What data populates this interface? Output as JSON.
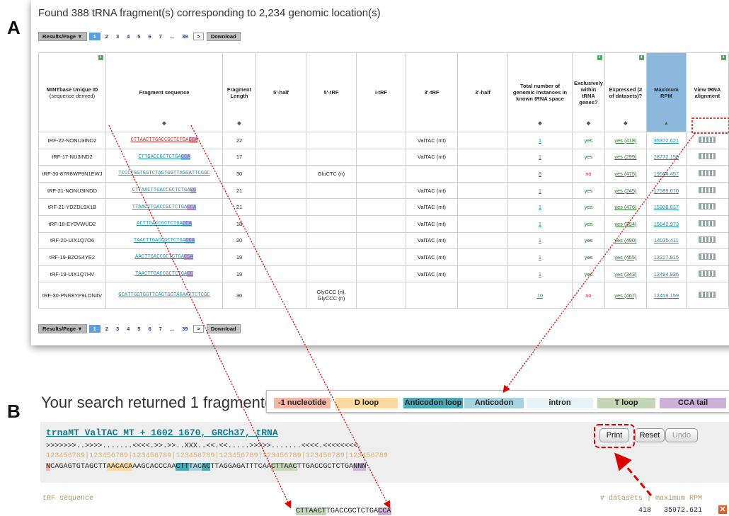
{
  "panelA": {
    "letter": "A",
    "found_text": "Found 388 tRNA fragment(s) corresponding to 2,234 genomic location(s)",
    "pager": {
      "results_per_page": "Results/Page ▼",
      "pages": [
        "1",
        "2",
        "3",
        "4",
        "5",
        "6",
        "7",
        "...",
        "39"
      ],
      "current_page": "1",
      "next": ">",
      "download": "Download"
    },
    "columns": [
      {
        "label": "MINTbase Unique ID",
        "sub": "(sequence derived)",
        "info": true,
        "sort": ""
      },
      {
        "label": "Fragment sequence",
        "sub": "",
        "info": false,
        "sort": "◆"
      },
      {
        "label": "Fragment Length",
        "sub": "",
        "info": false,
        "sort": "◆"
      },
      {
        "label": "5'-half",
        "sub": "",
        "info": false,
        "sort": ""
      },
      {
        "label": "5'-tRF",
        "sub": "",
        "info": false,
        "sort": ""
      },
      {
        "label": "i-tRF",
        "sub": "",
        "info": false,
        "sort": ""
      },
      {
        "label": "3'-tRF",
        "sub": "",
        "info": false,
        "sort": ""
      },
      {
        "label": "3'-half",
        "sub": "",
        "info": false,
        "sort": ""
      },
      {
        "label": "Total number of genomic instances in known tRNA space",
        "sub": "",
        "info": false,
        "sort": "◆"
      },
      {
        "label": "Exclusively within tRNA genes?",
        "sub": "",
        "info": true,
        "sort": "◆"
      },
      {
        "label": "Expressed (# of datasets)?",
        "sub": "",
        "info": true,
        "sort": "◆"
      },
      {
        "label": "Maximum RPM",
        "sub": "",
        "info": false,
        "sort": "▲"
      },
      {
        "label": "View tRNA alignment",
        "sub": "",
        "info": true,
        "sort": ""
      }
    ],
    "rows": [
      {
        "id": "tRF-22-NONU3IND2",
        "seq": "CTTAACTTGACCGCTCTGA",
        "cca": "CCA",
        "len": "22",
        "half5": "",
        "trf5": "",
        "itrf": "",
        "trf3": "ValTAC (mt)",
        "half3": "",
        "total": "1",
        "excl": "yes",
        "expr": "yes (418)",
        "rpm": "35972.621"
      },
      {
        "id": "tRF-17-NU3IND2",
        "seq": "CTTGACCGCTCTGA",
        "cca": "CCA",
        "len": "17",
        "half5": "",
        "trf5": "",
        "itrf": "",
        "trf3": "ValTAC (mt)",
        "half3": "",
        "total": "1",
        "excl": "yes",
        "expr": "yes (299)",
        "rpm": "28772.150"
      },
      {
        "id": "tRF-30-87R8WP9N1EWJ",
        "seq": "TCCCTGGTGGTCTAGTGGTTAGGATTCGGC",
        "cca": "",
        "len": "30",
        "half5": "",
        "trf5": "GluCTC (n)",
        "itrf": "",
        "trf3": "",
        "half3": "",
        "total": "8",
        "excl": "no",
        "expr": "yes (475)",
        "rpm": "19564.457"
      },
      {
        "id": "tRF-21-NONU3INDD",
        "seq": "CTTAACTTGACCGCTCTGA",
        "cca": "CC",
        "len": "21",
        "half5": "",
        "trf5": "",
        "itrf": "",
        "trf3": "ValTAC (mt)",
        "half3": "",
        "total": "1",
        "excl": "yes",
        "expr": "yes (245)",
        "rpm": "17589.670"
      },
      {
        "id": "tRF-21-YDZDL9X1B",
        "seq": "TTAACTTGACCGCTCTGA",
        "cca": "CCA",
        "len": "21",
        "half5": "",
        "trf5": "",
        "itrf": "",
        "trf3": "ValTAC (mt)",
        "half3": "",
        "total": "1",
        "excl": "yes",
        "expr": "yes (476)",
        "rpm": "15808.837"
      },
      {
        "id": "tRF-18-EY0VWUD2",
        "seq": "ACTTGACCGCTCTGA",
        "cca": "CCA",
        "len": "18",
        "half5": "",
        "trf5": "",
        "itrf": "",
        "trf3": "ValTAC (mt)",
        "half3": "",
        "total": "1",
        "excl": "yes",
        "expr": "yes (394)",
        "rpm": "15642.973"
      },
      {
        "id": "tRF-20-UIX1Q7O6",
        "seq": "TAACTTGACCGCTCTGA",
        "cca": "CCA",
        "len": "20",
        "half5": "",
        "trf5": "",
        "itrf": "",
        "trf3": "ValTAC (mt)",
        "half3": "",
        "total": "1",
        "excl": "yes",
        "expr": "yes (490)",
        "rpm": "14035.411"
      },
      {
        "id": "tRF-19-BZOS4YE2",
        "seq": "AACTTGACCGCTCTGA",
        "cca": "CCA",
        "len": "19",
        "half5": "",
        "trf5": "",
        "itrf": "",
        "trf3": "ValTAC (mt)",
        "half3": "",
        "total": "1",
        "excl": "yes",
        "expr": "yes (455)",
        "rpm": "13227.815"
      },
      {
        "id": "tRF-19-UIX1Q7HV",
        "seq": "TAACTTGACCGCTCTGA",
        "cca": "CC",
        "len": "19",
        "half5": "",
        "trf5": "",
        "itrf": "",
        "trf3": "ValTAC (mt)",
        "half3": "",
        "total": "1",
        "excl": "yes",
        "expr": "yes (343)",
        "rpm": "12494.836"
      },
      {
        "id": "tRF-30-PNR8YP9LON4V",
        "seq": "GCATTGGTGGTTCAGTGGTAGAATTCTCGC",
        "cca": "",
        "len": "30",
        "half5": "",
        "trf5": "GlyGCC (n), GlyCCC (n)",
        "itrf": "",
        "trf3": "",
        "half3": "",
        "total": "10",
        "excl": "no",
        "expr": "yes (467)",
        "rpm": "12459.159"
      }
    ]
  },
  "panelB": {
    "letter": "B",
    "returned_text": "Your search returned 1 fragment(s)",
    "legend": [
      {
        "label": "-1 nucleotide",
        "color": "#f4b5a4"
      },
      {
        "label": "D loop",
        "color": "#fcd9a0"
      },
      {
        "label": "Anticodon loop",
        "color": "#4aaab6"
      },
      {
        "label": "Anticodon",
        "color": "#a6d4de"
      },
      {
        "label": "intron",
        "color": "#e6f3f6"
      },
      {
        "label": "T loop",
        "color": "#c4d6b6"
      },
      {
        "label": "CCA tail",
        "color": "#cdb0d8"
      }
    ],
    "trna_name": "trnaMT_ValTAC_MT_+_1602_1670, GRCh37, tRNA",
    "structure": ">>>>>>>..>>>>.......<<<<.>>.>>..XXX..<<.<<.....>>>>>.......<<<<.<<<<<<<<.",
    "ruler": "123456789|123456789|123456789|123456789|123456789|123456789|123456789|123456789",
    "sequence_parts": [
      {
        "t": "N",
        "c": "#f4b5a4"
      },
      {
        "t": "CAGAGTGTAGCTT",
        "c": ""
      },
      {
        "t": "AACACA",
        "c": "#fcd9a0"
      },
      {
        "t": "AAGCACCCAA",
        "c": ""
      },
      {
        "t": "CTT",
        "c": "#4aaab6"
      },
      {
        "t": "TAC",
        "c": "#a6d4de"
      },
      {
        "t": "AC",
        "c": "#4aaab6"
      },
      {
        "t": "TTAGGAGATTTCAA",
        "c": ""
      },
      {
        "t": "CTTAAC",
        "c": "#c4d6b6"
      },
      {
        "t": "TTGACCGCTCTGA",
        "c": ""
      },
      {
        "t": "NNN",
        "c": "#cdb0d8"
      }
    ],
    "buttons": {
      "print": "Print",
      "reset": "Reset",
      "undo": "Undo"
    },
    "trf_label": "tRF sequence",
    "datasets_label": "# datasets | maximum RPM",
    "trf_parts": [
      {
        "t": "CTTAACT",
        "c": "#c4d6b6"
      },
      {
        "t": "TGACCGCTCTGA",
        "c": ""
      },
      {
        "t": "CCA",
        "c": "#cdb0d8"
      }
    ],
    "datasets_value": "418",
    "rpm_value": "35972.621",
    "close_glyph": "✕"
  }
}
